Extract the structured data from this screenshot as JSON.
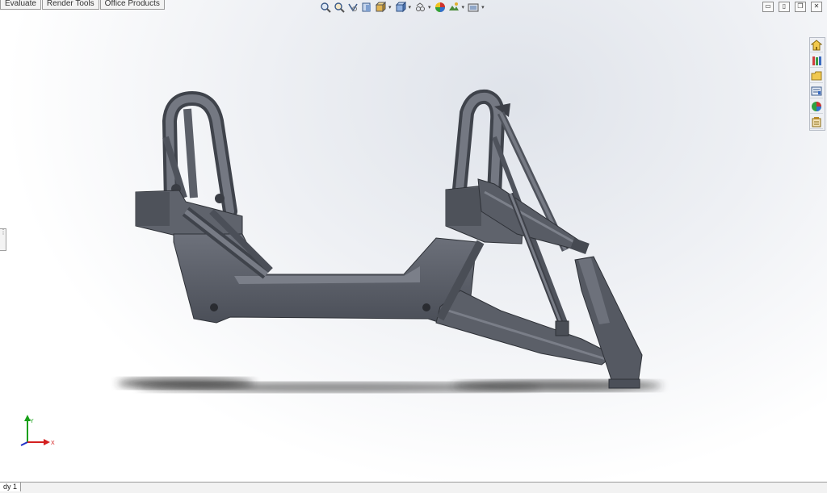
{
  "command_tabs": [
    {
      "label": "Evaluate"
    },
    {
      "label": "Render Tools"
    },
    {
      "label": "Office Products"
    }
  ],
  "heads_up_toolbar": {
    "icons": [
      "zoom-to-fit-icon",
      "zoom-to-area-icon",
      "previous-view-icon",
      "section-view-icon",
      "view-orientation-icon",
      "display-style-icon",
      "hide-show-items-icon",
      "edit-appearance-icon",
      "apply-scene-icon",
      "view-settings-icon"
    ]
  },
  "window_controls": [
    "tile-horizontal-icon",
    "tile-vertical-icon",
    "restore-icon",
    "close-icon"
  ],
  "task_pane": {
    "icons": [
      "solidworks-resources-icon",
      "design-library-icon",
      "file-explorer-icon",
      "view-palette-icon",
      "appearances-scenes-icon",
      "custom-properties-icon"
    ]
  },
  "model_tabs": {
    "active": "dy 1"
  },
  "triad": {
    "x_label": "X",
    "y_label": "Y",
    "colors": {
      "x": "#d42020",
      "y": "#18a018",
      "z": "#2030c8"
    }
  },
  "model": {
    "color": "#5a5e68",
    "shadow_color": "#2a2a2a"
  }
}
